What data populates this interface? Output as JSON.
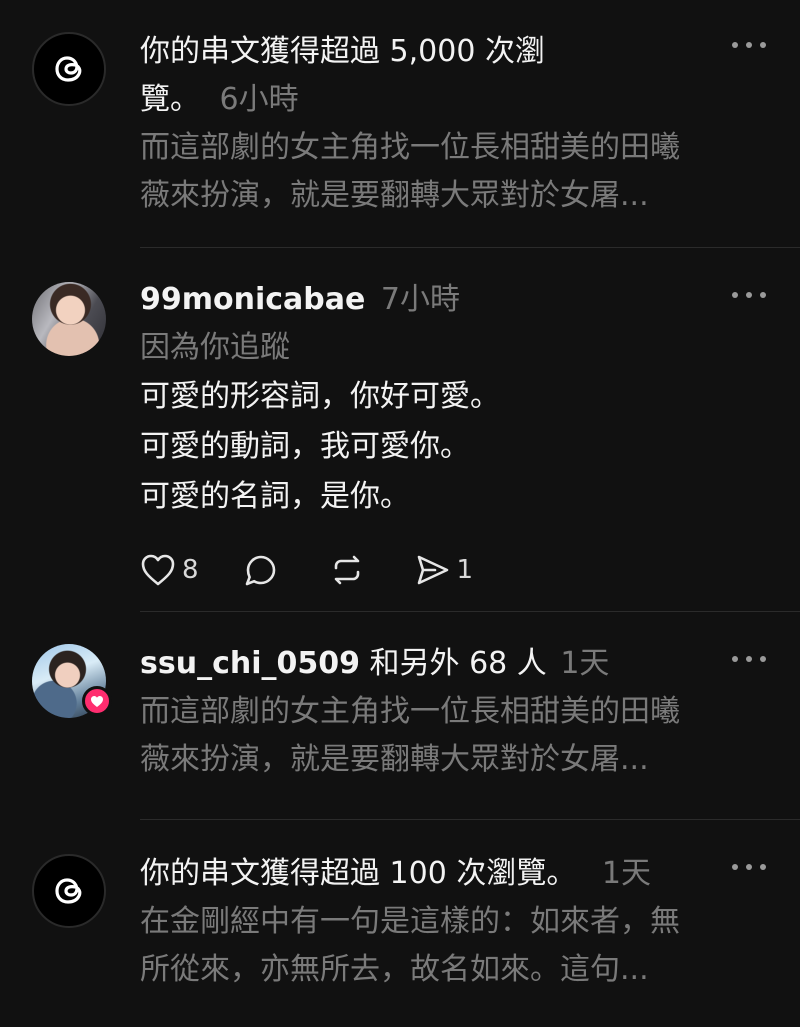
{
  "notifications": [
    {
      "headline_line1": "你的串文獲得超過 5,000 次瀏",
      "headline_line2": "覽。",
      "time": "6小時",
      "preview_line1": "而這部劇的女主角找一位長相甜美的田曦",
      "preview_line2": "薇來扮演，就是要翻轉大眾對於女屠..."
    },
    {
      "username": "99monicabae",
      "time": "7小時",
      "reason": "因為你追蹤",
      "lines": [
        "可愛的形容詞，你好可愛。",
        "可愛的動詞，我可愛你。",
        "可愛的名詞，是你。"
      ],
      "like_count": "8",
      "share_count": "1"
    },
    {
      "username": "ssu_chi_0509",
      "others": "和另外 68 人",
      "time": "1天",
      "preview_line1": "而這部劇的女主角找一位長相甜美的田曦",
      "preview_line2": "薇來扮演，就是要翻轉大眾對於女屠..."
    },
    {
      "headline": "你的串文獲得超過 100 次瀏覽。",
      "time": "1天",
      "preview_line1": "在金剛經中有一句是這樣的：如來者，無",
      "preview_line2": "所從來，亦無所去，故名如來。這句..."
    }
  ],
  "icons": {
    "threads": "threads-logo-icon",
    "more": "more-horizontal-icon",
    "like": "heart-icon",
    "comment": "comment-icon",
    "repost": "repost-icon",
    "share": "send-icon",
    "badge": "heart-badge-icon"
  },
  "colors": {
    "background": "#111111",
    "text": "#f3f3f3",
    "muted": "#7a7a7a",
    "badge": "#ff2d6f"
  }
}
